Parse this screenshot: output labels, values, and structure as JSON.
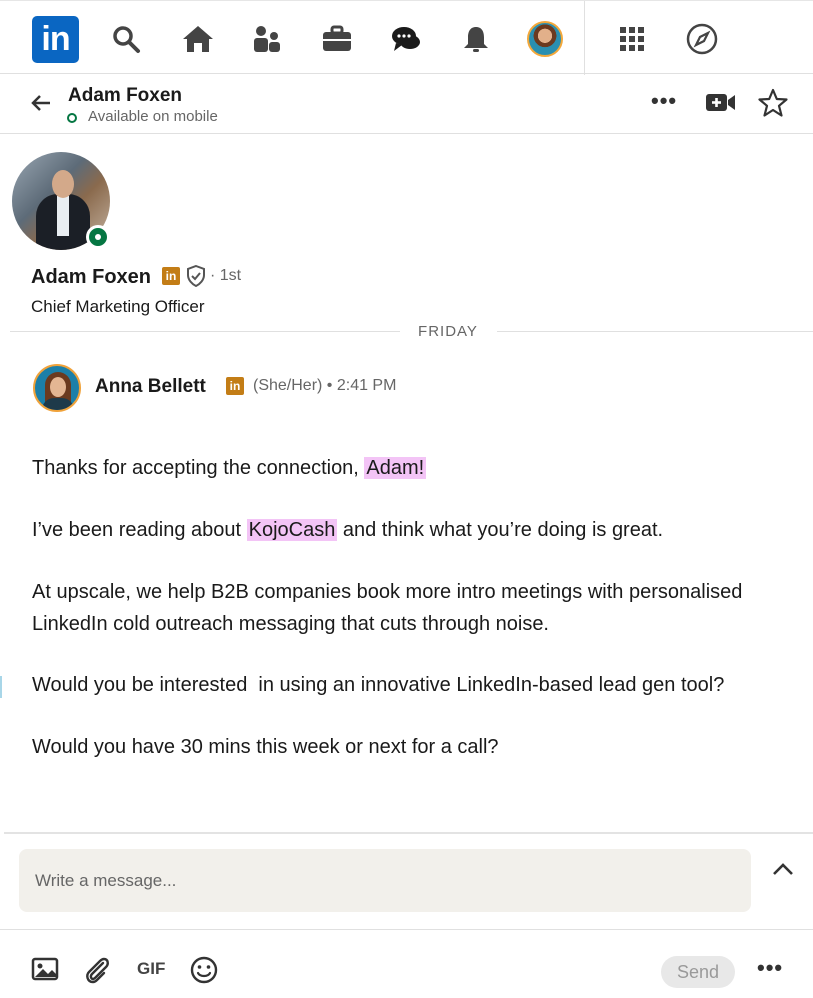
{
  "nav": {
    "logo_text": "in",
    "icons": [
      "search-icon",
      "home-icon",
      "network-icon",
      "jobs-icon",
      "messaging-icon",
      "notifications-icon",
      "me-avatar",
      "apps-grid-icon",
      "compass-icon"
    ]
  },
  "chat_header": {
    "name": "Adam Foxen",
    "status": "Available on mobile",
    "more_label": "•••"
  },
  "profile": {
    "name": "Adam Foxen",
    "badge": "in",
    "degree": "· 1st",
    "title": "Chief Marketing Officer"
  },
  "day_divider": "FRIDAY",
  "message": {
    "sender": "Anna Bellett",
    "badge": "in",
    "meta": "(She/Her) • 2:41 PM",
    "p1_pre": "Thanks for accepting the connection, ",
    "p1_highlight": "Adam!",
    "p2_pre": "I’ve been reading about ",
    "p2_highlight": "KojoCash",
    "p2_post": " and think what you’re doing is great.",
    "p3": "At upscale, we help B2B companies book more intro meetings with personalised LinkedIn cold outreach messaging that cuts through noise.",
    "p4": "Would you be interested  in using an innovative LinkedIn-based lead gen tool?",
    "p5": "Would you have 30 mins this week or next for a call?"
  },
  "compose": {
    "placeholder": "Write a message...",
    "gif_label": "GIF",
    "send_label": "Send",
    "more_label": "•••"
  },
  "colors": {
    "brand": "#0a66c2",
    "online": "#057642",
    "highlight": "#f3c4f6",
    "premium_badge": "#c37d16"
  }
}
